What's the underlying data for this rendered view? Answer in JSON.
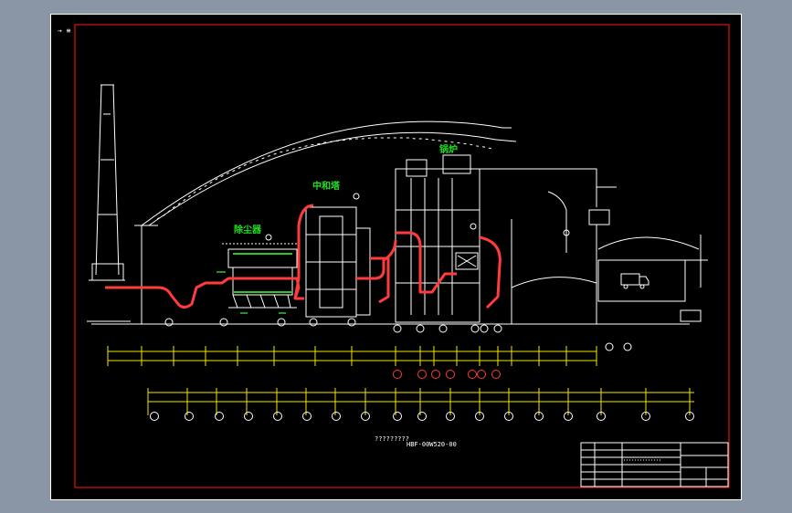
{
  "drawing": {
    "corner_mark": "→ ≡",
    "labels": {
      "dust_collector": "除尘器",
      "neutralization_tower": "中和塔",
      "boiler": "锅炉"
    },
    "title_block": {
      "drawing_name": "?????????",
      "drawing_number": "HBF-00W520-00"
    },
    "colors": {
      "frame": "#e01010",
      "lines": "#ffffff",
      "flue": "#ff3b3b",
      "label": "#22dd22",
      "dim": "#f2e600"
    }
  }
}
